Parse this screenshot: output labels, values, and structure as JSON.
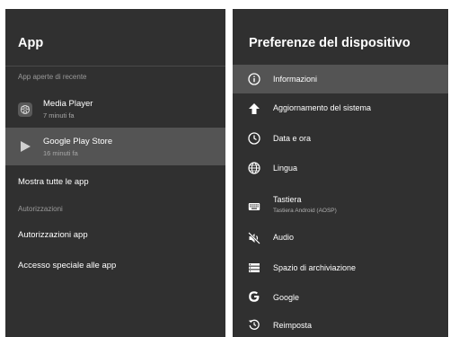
{
  "left": {
    "title": "App",
    "recent_section": "App aperte di recente",
    "recent_apps": [
      {
        "name": "Media Player",
        "time": "7 minuti fa"
      },
      {
        "name": "Google Play Store",
        "time": "16 minuti fa"
      }
    ],
    "show_all": "Mostra tutte le app",
    "permissions_section": "Autorizzazioni",
    "app_permissions": "Autorizzazioni app",
    "special_access": "Accesso speciale alle app"
  },
  "right": {
    "title": "Preferenze del dispositivo",
    "items": [
      {
        "label": "Informazioni",
        "icon": "info-icon"
      },
      {
        "label": "Aggiornamento del sistema",
        "icon": "arrow-up-icon"
      },
      {
        "label": "Data e ora",
        "icon": "clock-icon"
      },
      {
        "label": "Lingua",
        "icon": "globe-icon"
      },
      {
        "label": "Tastiera",
        "sublabel": "Tastiera Android (AOSP)",
        "icon": "keyboard-icon"
      },
      {
        "label": "Audio",
        "icon": "speaker-muted-icon"
      },
      {
        "label": "Spazio di archiviazione",
        "icon": "storage-icon"
      },
      {
        "label": "Google",
        "icon": "google-icon"
      },
      {
        "label": "Reimposta",
        "icon": "reset-icon"
      }
    ]
  },
  "colors": {
    "panel_bg": "#303030",
    "selected_bg": "#545454",
    "text": "#ffffff",
    "secondary_text": "#9a9a9a"
  }
}
